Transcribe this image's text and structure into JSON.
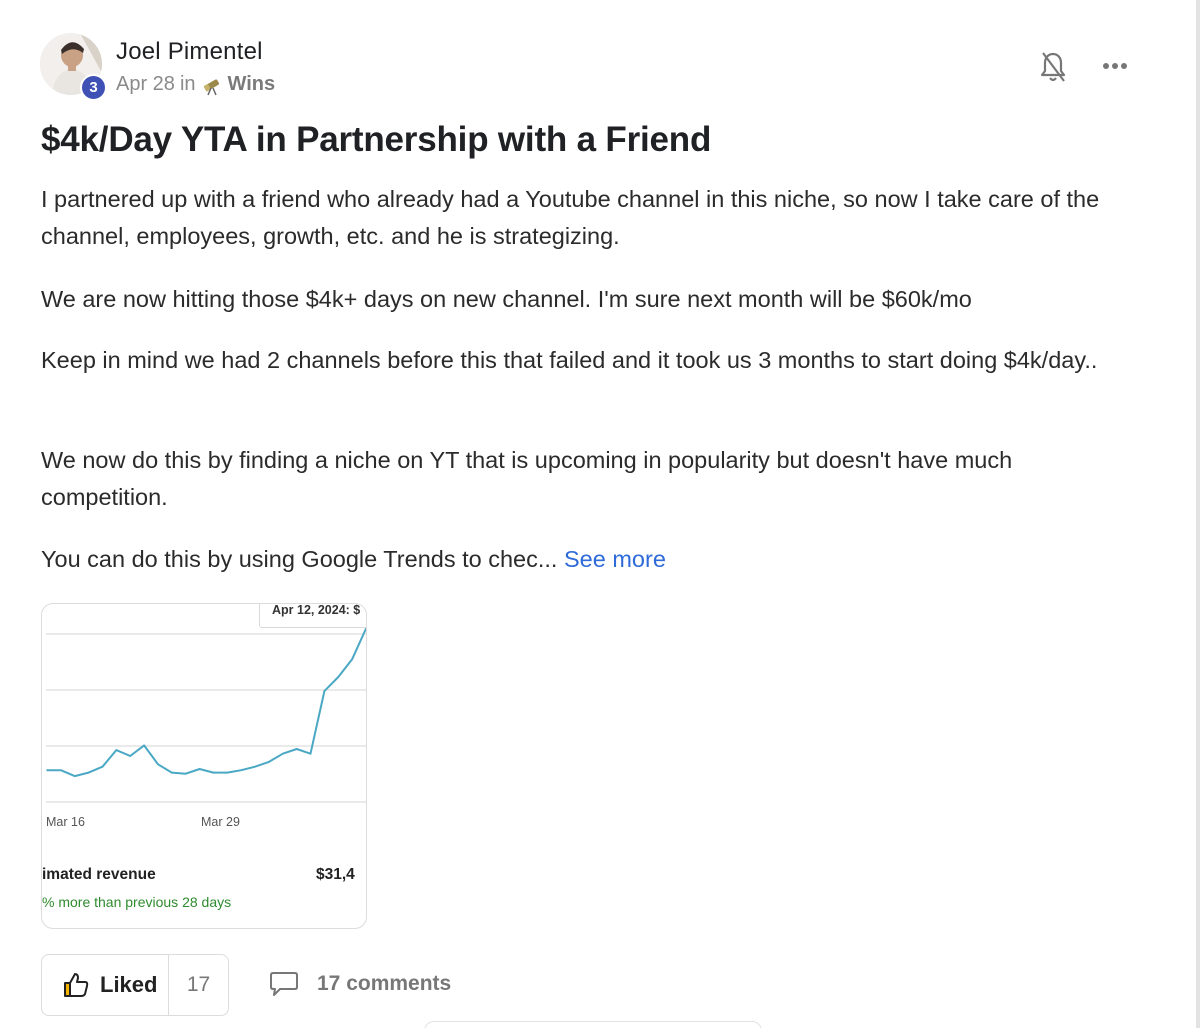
{
  "post": {
    "author": "Joel Pimentel",
    "level": "3",
    "date": "Apr 28",
    "in_text": "in",
    "category": "Wins",
    "title": "$4k/Day YTA in Partnership with a Friend",
    "paragraphs": [
      "I partnered up with a friend who already had a Youtube channel in this niche, so now I take care of the channel, employees, growth, etc. and he is strategizing.",
      "We are now hitting those $4k+ days on new channel. I'm sure next month will be $60k/mo",
      "Keep in mind we had 2 channels before this that failed and it took us 3 months to start doing $4k/day..",
      "We now do this by finding a niche on YT that is upcoming in popularity but doesn't have much competition.",
      "You can do this by using Google Trends to chec..."
    ],
    "see_more": "See more"
  },
  "chart_image": {
    "tooltip": "Apr 12, 2024: $",
    "x_ticks": [
      "Mar 16",
      "Mar 29"
    ],
    "revenue_label": "imated revenue",
    "revenue_value": "$31,4",
    "revenue_change": "% more than previous 28 days",
    "line_color": "#4aa8c4"
  },
  "chart_data": {
    "type": "line",
    "title": "",
    "xlabel": "",
    "ylabel": "",
    "x_ticks": [
      "Mar 16",
      "Mar 29"
    ],
    "series": [
      {
        "values": [
          0.1,
          0.1,
          0.05,
          0.08,
          0.13,
          0.27,
          0.22,
          0.31,
          0.15,
          0.08,
          0.07,
          0.11,
          0.08,
          0.08,
          0.1,
          0.13,
          0.17,
          0.24,
          0.28,
          0.24,
          0.77,
          0.89,
          1.04,
          1.3
        ]
      }
    ],
    "grid": true
  },
  "actions": {
    "like_label": "Liked",
    "like_count": "17",
    "comments_label": "17 comments"
  }
}
